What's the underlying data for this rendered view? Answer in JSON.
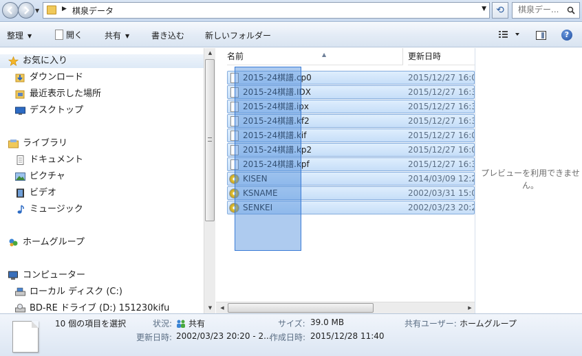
{
  "address_bar": {
    "breadcrumb": "棋泉データ",
    "search_placeholder": "棋泉デー..."
  },
  "toolbar": {
    "organize": "整理",
    "open": "開く",
    "share": "共有",
    "burn": "書き込む",
    "new_folder": "新しいフォルダー"
  },
  "nav": {
    "favorites": "お気に入り",
    "downloads": "ダウンロード",
    "recent": "最近表示した場所",
    "desktop": "デスクトップ",
    "libraries": "ライブラリ",
    "documents": "ドキュメント",
    "pictures": "ピクチャ",
    "videos": "ビデオ",
    "music": "ミュージック",
    "homegroup": "ホームグループ",
    "computer": "コンピューター",
    "local_disk": "ローカル ディスク (C:)",
    "bd_drive": "BD-RE ドライブ (D:) 151230kifu"
  },
  "filelist": {
    "col_name": "名前",
    "col_date": "更新日時",
    "files": [
      {
        "name": "2015-24棋譜.cp0",
        "date": "2015/12/27 16:0",
        "icon": "file-icon"
      },
      {
        "name": "2015-24棋譜.IDX",
        "date": "2015/12/27 16:3",
        "icon": "file-icon"
      },
      {
        "name": "2015-24棋譜.ipx",
        "date": "2015/12/27 16:3",
        "icon": "file-icon"
      },
      {
        "name": "2015-24棋譜.kf2",
        "date": "2015/12/27 16:3",
        "icon": "file-icon"
      },
      {
        "name": "2015-24棋譜.kif",
        "date": "2015/12/27 16:0",
        "icon": "file-icon"
      },
      {
        "name": "2015-24棋譜.kp2",
        "date": "2015/12/27 16:0",
        "icon": "file-icon"
      },
      {
        "name": "2015-24棋譜.kpf",
        "date": "2015/12/27 16:3",
        "icon": "file-icon"
      },
      {
        "name": "KISEN",
        "date": "2014/03/09 12:2",
        "icon": "disc-setup-icon"
      },
      {
        "name": "KSNAME",
        "date": "2002/03/31 15:0",
        "icon": "disc-setup-icon"
      },
      {
        "name": "SENKEI",
        "date": "2002/03/23 20:2",
        "icon": "disc-setup-icon"
      }
    ]
  },
  "preview": {
    "message": "プレビューを利用できません。"
  },
  "details": {
    "selection": "10 個の項目を選択",
    "status_label": "状況:",
    "status_value": "共有",
    "size_label": "サイズ:",
    "size_value": "39.0 MB",
    "shared_label": "共有ユーザー:",
    "shared_value": "ホームグループ",
    "modified_label": "更新日時:",
    "modified_value": "2002/03/23 20:20 - 2...",
    "created_label": "作成日時:",
    "created_value": "2015/12/28 11:40"
  },
  "colors": {
    "selection_fill": "#c6def8",
    "selection_border": "#84acdd",
    "rubber_band": "#4b8cdc",
    "toolbar_bg": "#e4ecf6"
  }
}
